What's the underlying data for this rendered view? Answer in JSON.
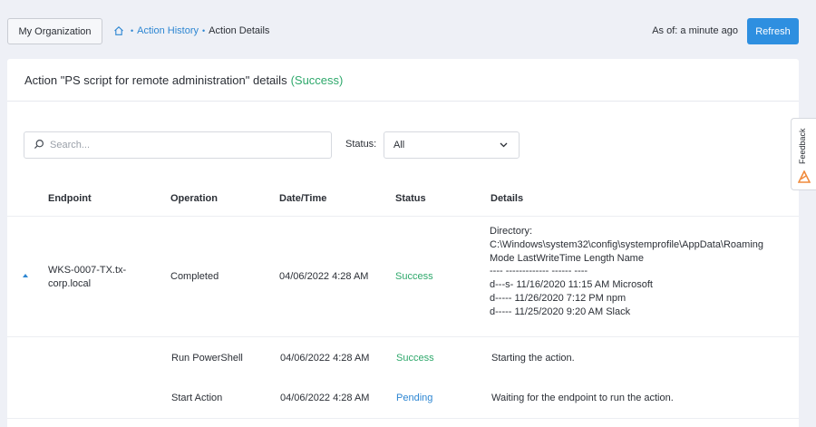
{
  "header": {
    "org_button": "My Organization",
    "breadcrumb": {
      "link": "Action History",
      "current": "Action Details"
    },
    "as_of": "As of: a minute ago",
    "refresh": "Refresh"
  },
  "panel": {
    "title": "Action \"PS script for remote administration\" details",
    "title_status": "(Success)"
  },
  "filters": {
    "search_placeholder": "Search...",
    "status_label": "Status:",
    "status_value": "All"
  },
  "table": {
    "columns": [
      "Endpoint",
      "Operation",
      "Date/Time",
      "Status",
      "Details"
    ],
    "main_row": {
      "endpoint_line1": "WKS-0007-TX.tx-",
      "endpoint_line2": "corp.local",
      "operation": "Completed",
      "datetime": "04/06/2022 4:28 AM",
      "status": "Success",
      "details": [
        "Directory:",
        "C:\\Windows\\system32\\config\\systemprofile\\AppData\\Roaming",
        "",
        "Mode LastWriteTime Length Name",
        "---- ------------- ------ ----",
        "d---s- 11/16/2020 11:15 AM Microsoft",
        "d----- 11/26/2020 7:12 PM npm",
        "d----- 11/25/2020 9:20 AM Slack"
      ]
    },
    "sub_rows": [
      {
        "operation": "Run PowerShell",
        "datetime": "04/06/2022 4:28 AM",
        "status": "Success",
        "details": "Starting the action."
      },
      {
        "operation": "Start Action",
        "datetime": "04/06/2022 4:28 AM",
        "status": "Pending",
        "details": "Waiting for the endpoint to run the action."
      }
    ]
  },
  "feedback": {
    "label": "Feedback"
  },
  "colors": {
    "accent": "#2e8fe0",
    "success": "#2ea86b",
    "link": "#2d86d2",
    "feedback_icon": "#f08a3c"
  }
}
